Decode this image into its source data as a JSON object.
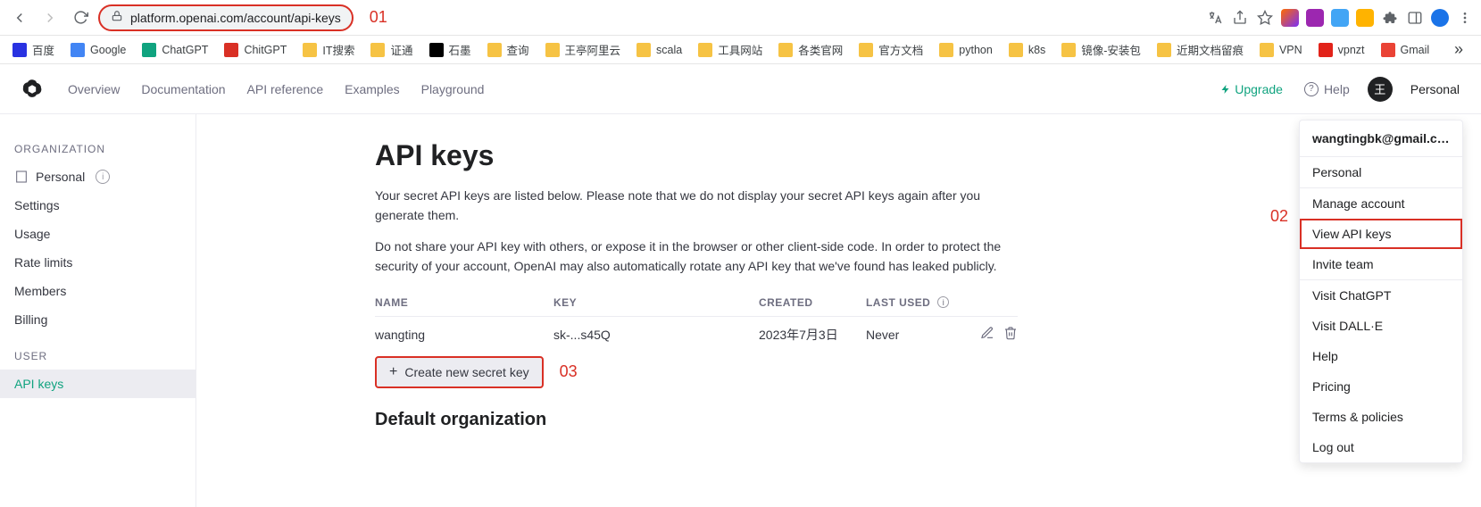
{
  "browser": {
    "url": "platform.openai.com/account/api-keys",
    "annot01": "01"
  },
  "bookmarks": [
    {
      "label": "百度",
      "color": "#2932e1"
    },
    {
      "label": "Google",
      "color": "#4285f4"
    },
    {
      "label": "ChatGPT",
      "color": "#10a37f"
    },
    {
      "label": "ChitGPT",
      "color": "#d93025"
    },
    {
      "label": "IT搜索",
      "color": "#f6c344"
    },
    {
      "label": "证通",
      "color": "#f6c344"
    },
    {
      "label": "石墨",
      "color": "#000"
    },
    {
      "label": "查询",
      "color": "#f6c344"
    },
    {
      "label": "王亭阿里云",
      "color": "#f6c344"
    },
    {
      "label": "scala",
      "color": "#f6c344"
    },
    {
      "label": "工具网站",
      "color": "#f6c344"
    },
    {
      "label": "各类官网",
      "color": "#f6c344"
    },
    {
      "label": "官方文档",
      "color": "#f6c344"
    },
    {
      "label": "python",
      "color": "#f6c344"
    },
    {
      "label": "k8s",
      "color": "#f6c344"
    },
    {
      "label": "镜像-安装包",
      "color": "#f6c344"
    },
    {
      "label": "近期文档留痕",
      "color": "#f6c344"
    },
    {
      "label": "VPN",
      "color": "#f6c344"
    },
    {
      "label": "vpnzt",
      "color": "#e2231a"
    },
    {
      "label": "Gmail",
      "color": "#ea4335"
    }
  ],
  "header": {
    "nav": [
      "Overview",
      "Documentation",
      "API reference",
      "Examples",
      "Playground"
    ],
    "upgrade": "Upgrade",
    "help": "Help",
    "avatar_initial": "王",
    "personal": "Personal"
  },
  "sidebar": {
    "org_title": "ORGANIZATION",
    "org_item": "Personal",
    "org_items": [
      "Settings",
      "Usage",
      "Rate limits",
      "Members",
      "Billing"
    ],
    "user_title": "USER",
    "user_items": [
      "API keys"
    ]
  },
  "main": {
    "title": "API keys",
    "p1": "Your secret API keys are listed below. Please note that we do not display your secret API keys again after you generate them.",
    "p2": "Do not share your API key with others, or expose it in the browser or other client-side code. In order to protect the security of your account, OpenAI may also automatically rotate any API key that we've found has leaked publicly.",
    "cols": {
      "name": "NAME",
      "key": "KEY",
      "created": "CREATED",
      "last_used": "LAST USED"
    },
    "rows": [
      {
        "name": "wangting",
        "key": "sk-...s45Q",
        "created": "2023年7月3日",
        "last_used": "Never"
      }
    ],
    "create_label": "Create new secret key",
    "annot03": "03",
    "subheading": "Default organization"
  },
  "menu": {
    "email": "wangtingbk@gmail.com",
    "top": [
      "Personal"
    ],
    "manage": [
      "Manage account",
      "View API keys",
      "Invite team"
    ],
    "links": [
      "Visit ChatGPT",
      "Visit DALL·E",
      "Help",
      "Pricing",
      "Terms & policies",
      "Log out"
    ],
    "boxed_index": 1,
    "annot02": "02"
  }
}
